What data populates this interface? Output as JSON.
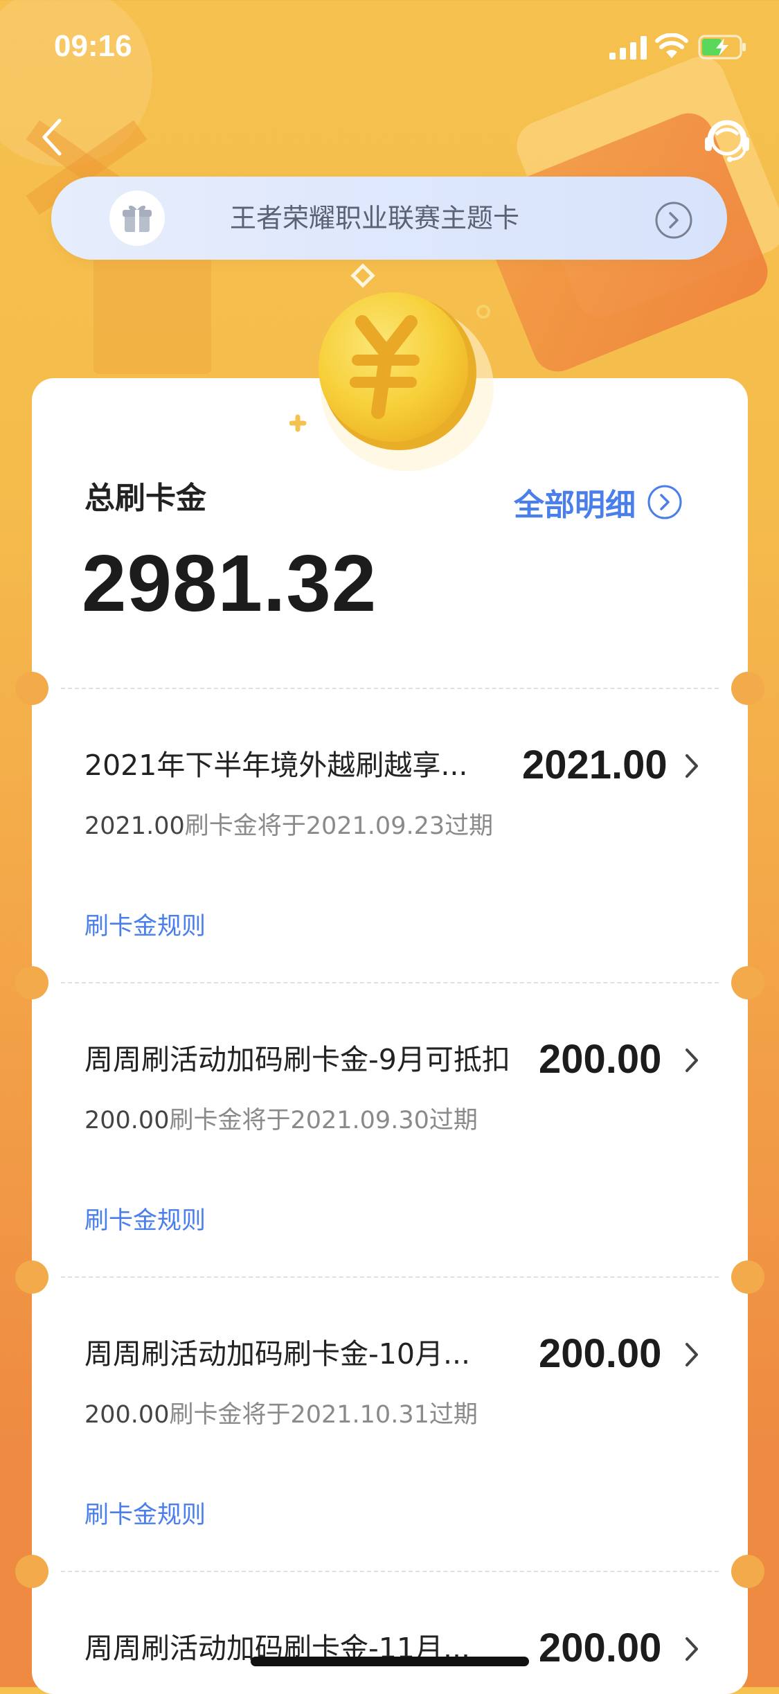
{
  "status_bar": {
    "time": "09:16"
  },
  "banner": {
    "title": "王者荣耀职业联赛主题卡"
  },
  "summary": {
    "label": "总刷卡金",
    "total": "2981.32",
    "details_link": "全部明细"
  },
  "items": [
    {
      "title": "2021年下半年境外越刷越享...",
      "amount": "2021.00",
      "expiry_amount": "2021.00",
      "expiry_text": "刷卡金将于2021.09.23过期",
      "rule_link": "刷卡金规则"
    },
    {
      "title": "周周刷活动加码刷卡金-9月可抵扣",
      "amount": "200.00",
      "expiry_amount": "200.00",
      "expiry_text": "刷卡金将于2021.09.30过期",
      "rule_link": "刷卡金规则"
    },
    {
      "title": "周周刷活动加码刷卡金-10月...",
      "amount": "200.00",
      "expiry_amount": "200.00",
      "expiry_text": "刷卡金将于2021.10.31过期",
      "rule_link": "刷卡金规则"
    },
    {
      "title": "周周刷活动加码刷卡金-11月...",
      "amount": "200.00"
    }
  ],
  "colors": {
    "accent_blue": "#4A7EEA",
    "background_orange": "#F3A448",
    "coin_gold": "#F9D43A"
  },
  "icons": {
    "back": "chevron-left-icon",
    "service": "customer-service-icon",
    "gift": "gift-icon",
    "banner_arrow": "circle-arrow-right-icon",
    "details_arrow": "circle-arrow-right-icon",
    "item_arrow": "chevron-right-icon",
    "coin": "yuan-coin-icon"
  }
}
